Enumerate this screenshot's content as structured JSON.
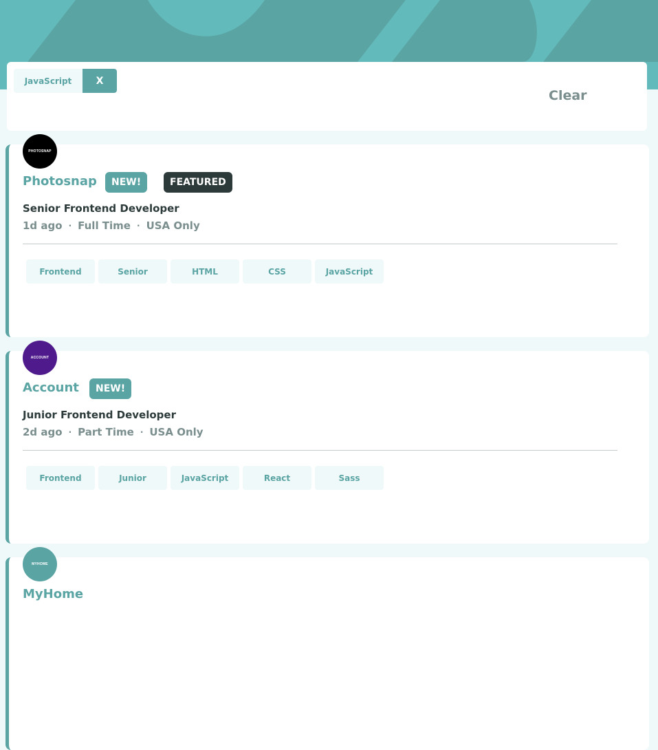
{
  "colors": {
    "primary": "#5ba4a4",
    "header_bg": "#63babb",
    "page_bg": "#eff9f9",
    "dark": "#2c3a3a",
    "muted": "#7b8e8e"
  },
  "filters": {
    "active": [
      "JavaScript"
    ],
    "remove_label": "X",
    "clear_label": "Clear"
  },
  "jobs": [
    {
      "company": "Photosnap",
      "logo_text": "PHOTOSNAP",
      "logo_color": "#000000",
      "new_label": "NEW!",
      "featured_label": "FEATURED",
      "position": "Senior Frontend Developer",
      "posted": "1d ago",
      "contract": "Full Time",
      "location": "USA Only",
      "tags": [
        "Frontend",
        "Senior",
        "HTML",
        "CSS",
        "JavaScript"
      ]
    },
    {
      "company": "Account",
      "logo_text": "ACCOUNT",
      "logo_color": "#4e1a8c",
      "new_label": "NEW!",
      "position": "Junior Frontend Developer",
      "posted": "2d ago",
      "contract": "Part Time",
      "location": "USA Only",
      "tags": [
        "Frontend",
        "Junior",
        "JavaScript",
        "React",
        "Sass"
      ]
    },
    {
      "company": "MyHome",
      "logo_text": "MYHOME",
      "logo_color": "#5ba4a4"
    }
  ]
}
